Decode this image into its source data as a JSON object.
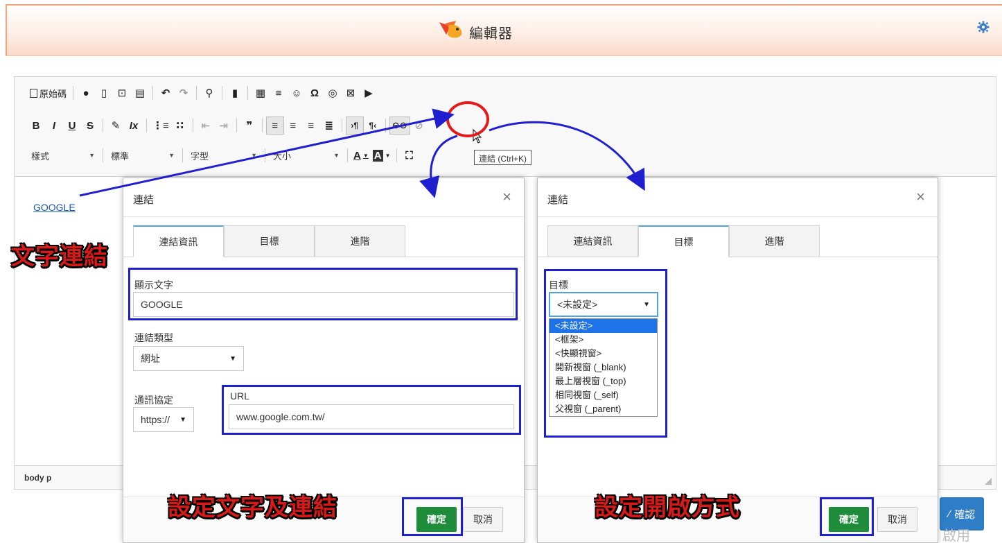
{
  "header": {
    "title": "編輯器",
    "logo_icon": "bird-logo",
    "settings_icon": "gear-icon"
  },
  "toolbar": {
    "source_label": "原始碼",
    "row1_icons": [
      "accessibility-icon",
      "new-page-icon",
      "preview-icon",
      "print-icon",
      "undo-icon",
      "redo-icon",
      "find-icon",
      "select-all-icon",
      "table-icon",
      "horizontal-line-icon",
      "smiley-icon",
      "special-char-icon",
      "globe-icon",
      "image-icon",
      "youtube-icon"
    ],
    "row2": {
      "bold": "B",
      "italic": "I",
      "underline": "U",
      "strike": "S",
      "row2_icons": [
        "copy-format-icon",
        "remove-format-icon",
        "numbered-list-icon",
        "bulleted-list-icon",
        "outdent-icon",
        "indent-icon",
        "blockquote-icon",
        "align-left-icon",
        "align-center-icon",
        "align-right-icon",
        "justify-icon",
        "ltr-icon",
        "rtl-icon",
        "link-icon",
        "unlink-icon"
      ]
    },
    "style_label": "樣式",
    "format_label": "標準",
    "font_label": "字型",
    "size_label": "大小",
    "text_color_label": "A",
    "bg_color_label": "A",
    "tooltip": "連結 (Ctrl+K)"
  },
  "editor": {
    "link_text": "GOOGLE",
    "path": "body  p"
  },
  "confirm_label": "確認",
  "watermark": "啟用 Window",
  "dialog_left": {
    "title": "連結",
    "close": "×",
    "tabs": [
      "連結資訊",
      "目標",
      "進階"
    ],
    "display_text_label": "顯示文字",
    "display_text_value": "GOOGLE",
    "link_type_label": "連結類型",
    "link_type_value": "網址",
    "protocol_label": "通訊協定",
    "protocol_value": "https://",
    "url_label": "URL",
    "url_value": "www.google.com.tw/",
    "ok": "確定",
    "cancel": "取消"
  },
  "dialog_right": {
    "title": "連結",
    "close": "×",
    "tabs": [
      "連結資訊",
      "目標",
      "進階"
    ],
    "target_label": "目標",
    "target_value": "<未設定>",
    "target_options": [
      "<未設定>",
      "<框架>",
      "<快顯視窗>",
      "開新視窗 (_blank)",
      "最上層視窗 (_top)",
      "相同視窗 (_self)",
      "父視窗 (_parent)"
    ],
    "ok": "確定",
    "cancel": "取消"
  },
  "callouts": {
    "text_link": "文字連結",
    "set_text_and_link": "設定文字及連結",
    "set_open_method": "設定開啟方式"
  },
  "colors": {
    "accent_blue": "#1f1fd0",
    "highlight_red": "#e31b1b",
    "ok_green": "#1e8c3a",
    "callout_red": "#d61a1a"
  }
}
